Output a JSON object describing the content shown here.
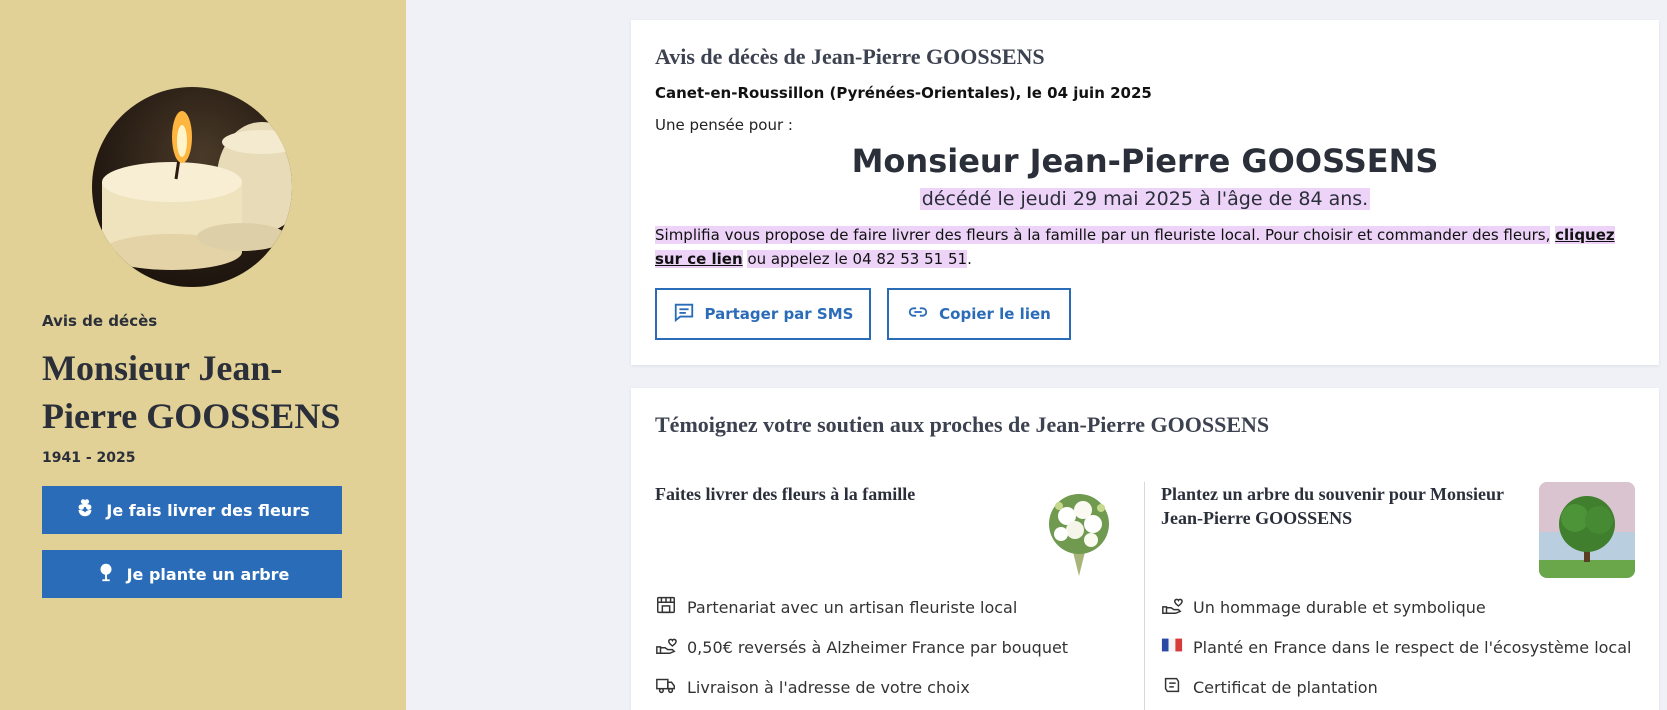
{
  "sidebar": {
    "kicker": "Avis de décès",
    "name": "Monsieur Jean-Pierre GOOSSENS",
    "years": "1941 - 2025",
    "flowers_button": "Je fais livrer des fleurs",
    "tree_button": "Je plante un arbre",
    "accent": "#2b6cb8",
    "background": "#e2d196"
  },
  "notice": {
    "title": "Avis de décès de Jean-Pierre GOOSSENS",
    "location": "Canet-en-Roussillon (Pyrénées-Orientales)",
    "date_text": ", le 04 juin 2025",
    "pensee": "Une pensée pour :",
    "full_name": "Monsieur Jean-Pierre GOOSSENS",
    "deceased_text": "décédé le jeudi 29 mai 2025 à l'âge de 84 ans.",
    "promo_text": "Simplifia vous propose de faire livrer des fleurs à la famille par un fleuriste local. Pour choisir et commander des fleurs,",
    "promo_link": "cliquez sur ce lien",
    "promo_phone": "ou appelez le 04 82 53 51 51",
    "promo_end": ".",
    "share_sms": "Partager par SMS",
    "copy_link": "Copier le lien"
  },
  "support": {
    "title": "Témoignez votre soutien aux proches de Jean-Pierre GOOSSENS",
    "flowers": {
      "title": "Faites livrer des fleurs à la famille",
      "features": [
        {
          "icon": "shop-icon",
          "text": "Partenariat avec un artisan fleuriste local"
        },
        {
          "icon": "hand-heart-icon",
          "text": "0,50€ reversés à Alzheimer France par bouquet"
        },
        {
          "icon": "truck-icon",
          "text": "Livraison à l'adresse de votre choix"
        }
      ]
    },
    "tree": {
      "title": "Plantez un arbre du souvenir pour Monsieur Jean-Pierre GOOSSENS",
      "features": [
        {
          "icon": "hand-heart-icon",
          "text": "Un hommage durable et symbolique"
        },
        {
          "icon": "france-flag-icon",
          "text": "Planté en France dans le respect de l'écosystème local"
        },
        {
          "icon": "certificate-icon",
          "text": "Certificat de plantation"
        }
      ]
    }
  }
}
